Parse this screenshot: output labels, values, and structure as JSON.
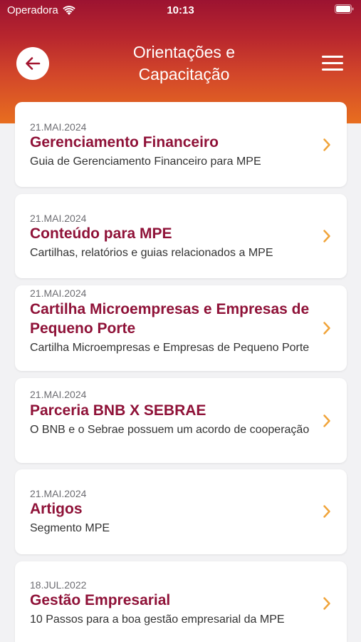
{
  "status": {
    "carrier": "Operadora",
    "time": "10:13"
  },
  "header": {
    "title_line1": "Orientações e",
    "title_line2": "Capacitação"
  },
  "colors": {
    "header_top": "#9c1331",
    "header_bottom": "#e86e1f",
    "title_color": "#8f1238",
    "chevron": "#f0a43a"
  },
  "items": [
    {
      "date": "21.MAI.2024",
      "title": "Gerenciamento Financeiro",
      "description": "Guia de Gerenciamento Financeiro para MPE"
    },
    {
      "date": "21.MAI.2024",
      "title": "Conteúdo para MPE",
      "description": "Cartilhas, relatórios e guias relacionados a MPE"
    },
    {
      "date": "21.MAI.2024",
      "title": "Cartilha Microempresas e Empresas de Pequeno Porte",
      "description": "Cartilha Microempresas e Empresas de Pequeno Porte"
    },
    {
      "date": "21.MAI.2024",
      "title": "Parceria BNB X SEBRAE",
      "description": "O BNB e o Sebrae possuem um acordo de cooperação"
    },
    {
      "date": "21.MAI.2024",
      "title": "Artigos",
      "description": "Segmento MPE"
    },
    {
      "date": "18.JUL.2022",
      "title": "Gestão Empresarial",
      "description": "10 Passos para a boa gestão empresarial da MPE"
    }
  ]
}
